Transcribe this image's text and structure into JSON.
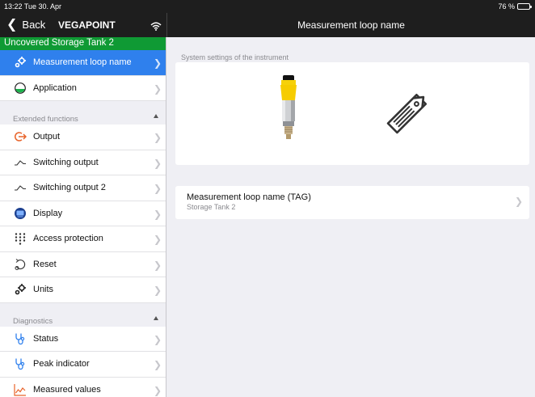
{
  "status_bar": {
    "time": "13:22  Tue 30. Apr",
    "battery": "76 %",
    "battery_level": 0.76
  },
  "nav": {
    "back_label": "Back",
    "app_title": "VEGAPOINT",
    "page_title": "Measurement loop name"
  },
  "sidebar": {
    "device_name": "Uncovered  Storage Tank 2",
    "items_top": [
      {
        "label": "Measurement loop name",
        "icon": "gears-icon",
        "active": true
      },
      {
        "label": "Application",
        "icon": "half-circle-icon",
        "active": false
      }
    ],
    "extended_label": "Extended functions",
    "items_extended": [
      {
        "label": "Output",
        "icon": "output-arrow-icon"
      },
      {
        "label": "Switching output",
        "icon": "switching-icon"
      },
      {
        "label": "Switching output 2",
        "icon": "switching-icon"
      },
      {
        "label": "Display",
        "icon": "display-icon"
      },
      {
        "label": "Access protection",
        "icon": "keypad-icon"
      },
      {
        "label": "Reset",
        "icon": "reset-icon"
      },
      {
        "label": "Units",
        "icon": "gears-icon"
      }
    ],
    "diagnostics_label": "Diagnostics",
    "items_diagnostics": [
      {
        "label": "Status",
        "icon": "stethoscope-icon"
      },
      {
        "label": "Peak indicator",
        "icon": "stethoscope-icon"
      },
      {
        "label": "Measured values",
        "icon": "chart-icon"
      }
    ]
  },
  "main": {
    "section_label": "System settings of the instrument",
    "tag_title": "Measurement loop name (TAG)",
    "tag_value": "Storage Tank 2"
  },
  "colors": {
    "accent": "#2f80ed",
    "device_green": "#0f9a34",
    "bar": "#1e1e1e",
    "output_orange": "#e8632a"
  }
}
